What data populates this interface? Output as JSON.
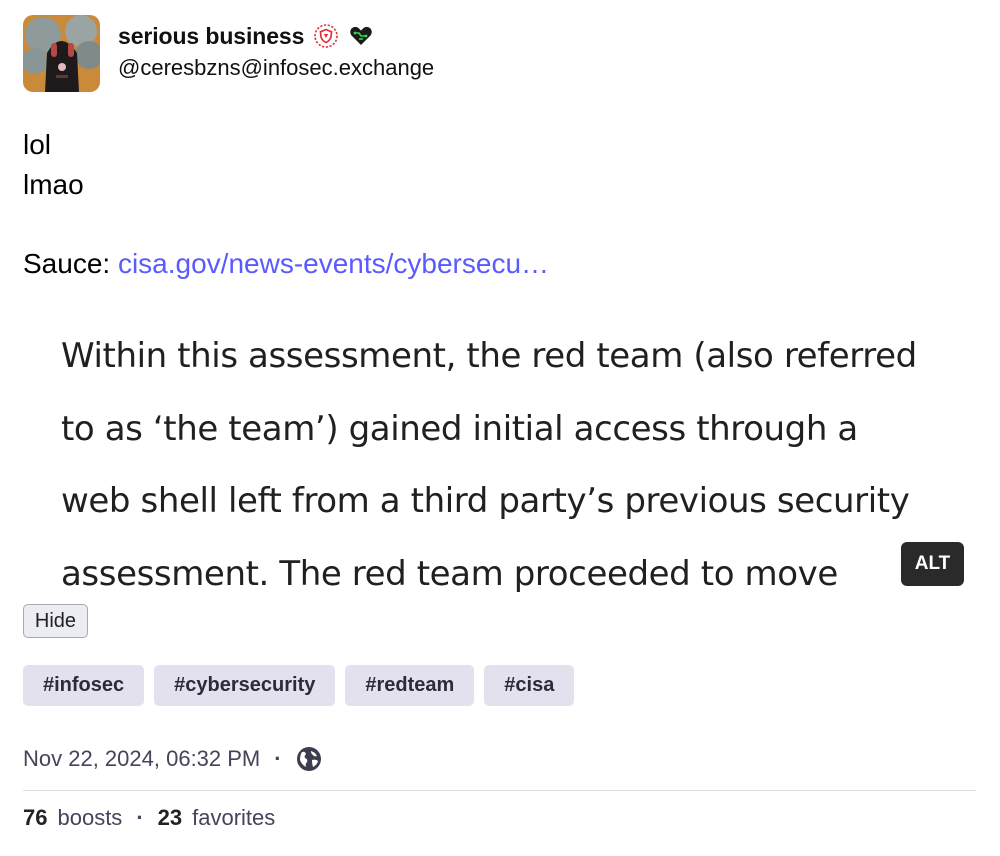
{
  "author": {
    "display_name": "serious business",
    "account": "@ceresbzns@infosec.exchange",
    "avatar": "avatar-image",
    "badges": [
      "shield-icon",
      "green-heart-circuit-icon"
    ]
  },
  "post": {
    "lines": [
      "lol",
      "lmao"
    ],
    "source_label": "Sauce:",
    "source_link": "cisa.gov/news-events/cybersecu…"
  },
  "media": {
    "text_lines": [
      "Within this assessment, the red team (also referred",
      "to as ‘the team’) gained initial access through a",
      "web shell left from a third party’s previous security",
      "assessment. The red team proceeded to move"
    ],
    "alt_label": "ALT",
    "hide_label": "Hide"
  },
  "tags": [
    "#infosec",
    "#cybersecurity",
    "#redteam",
    "#cisa"
  ],
  "meta": {
    "timestamp": "Nov 22, 2024, 06:32 PM",
    "separator": "·",
    "visibility_icon": "globe-icon"
  },
  "stats": {
    "boosts_count": "76",
    "boosts_label": "boosts",
    "favorites_count": "23",
    "favorites_label": "favorites"
  },
  "colors": {
    "link": "#595aff",
    "tag_bg": "#e3e1ee",
    "alt_bg": "#2a2a2a"
  }
}
